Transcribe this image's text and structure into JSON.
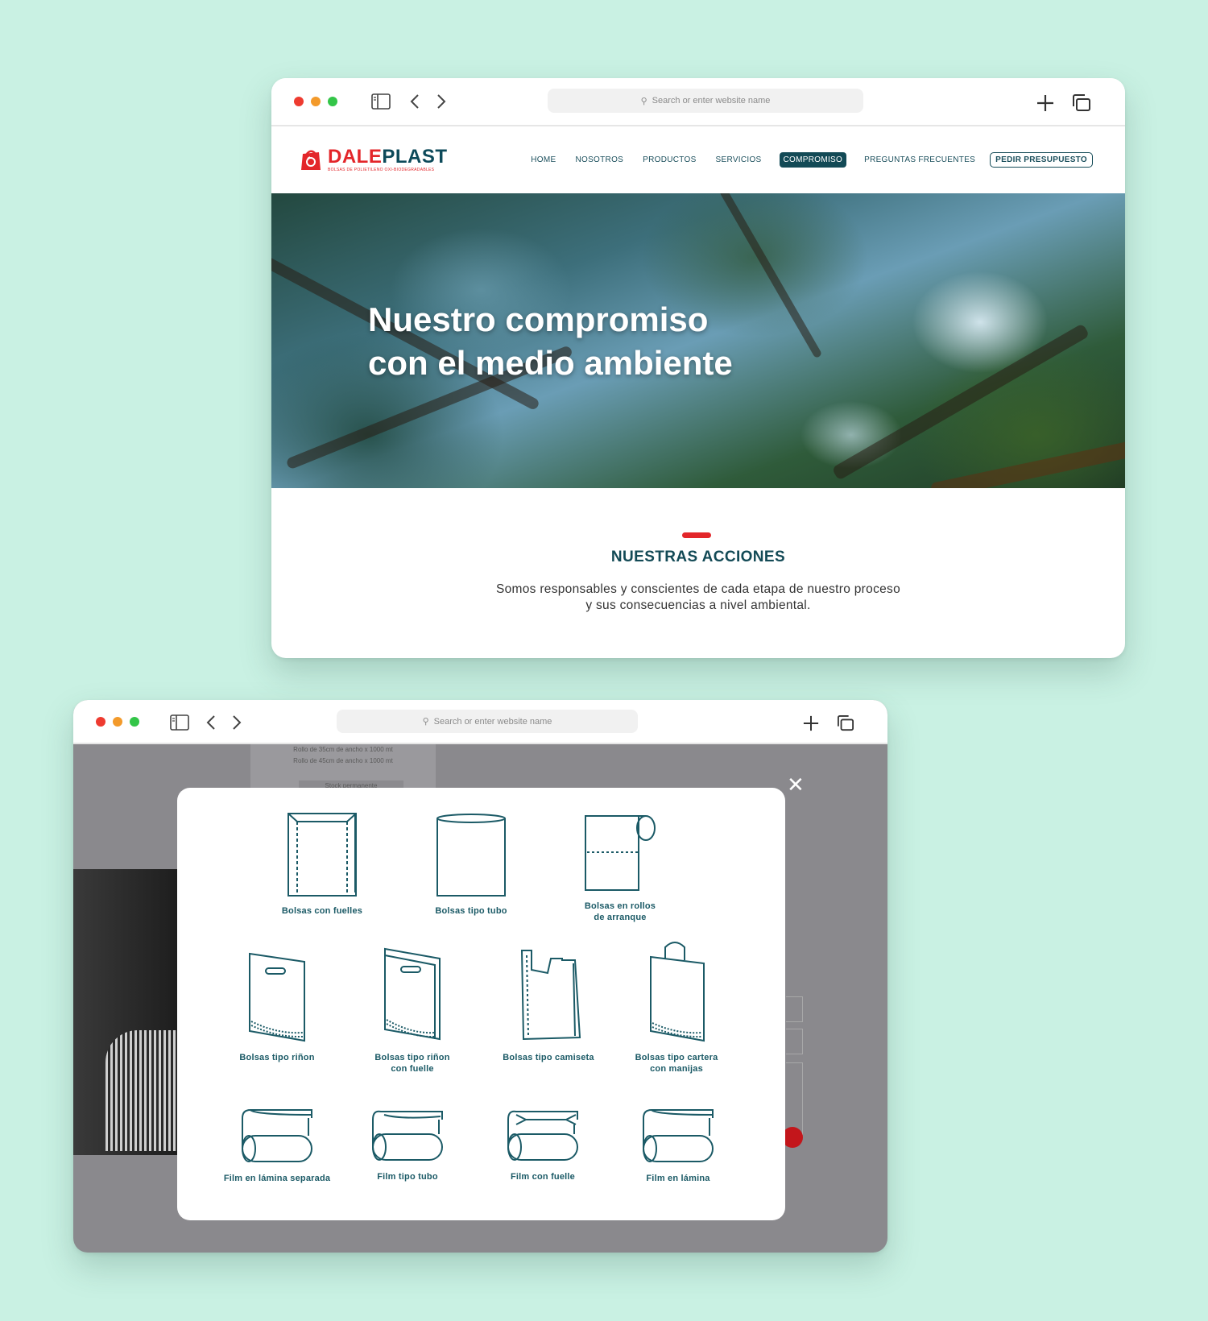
{
  "browser": {
    "url_placeholder": "Search or enter website name"
  },
  "site": {
    "logo": {
      "part1": "DALE",
      "part2": "PLAST",
      "tagline": "BOLSAS DE POLIETILENO OXI-BIODEGRADABLES"
    },
    "nav": [
      "HOME",
      "NOSOTROS",
      "PRODUCTOS",
      "SERVICIOS",
      "COMPROMISO",
      "PREGUNTAS FRECUENTES"
    ],
    "nav_active": "COMPROMISO",
    "cta": "PEDIR PRESUPUESTO",
    "hero": {
      "line1": "Nuestro compromiso",
      "line2": "con el medio ambiente"
    },
    "section": {
      "title": "NUESTRAS ACCIONES",
      "text_line1": "Somos responsables y conscientes de cada etapa de nuestro proceso",
      "text_line2": "y sus consecuencias a nivel ambiental."
    }
  },
  "background_page": {
    "card_line1": "Rollo de 35cm de ancho x 1000 mt",
    "card_line2": "Rollo de 45cm de ancho x 1000 mt",
    "card_badge": "Stock permanente"
  },
  "modal": {
    "row1": [
      {
        "label": "Bolsas con fuelles",
        "icon": "gusset-bag-icon"
      },
      {
        "label": "Bolsas tipo tubo",
        "icon": "tube-bag-icon"
      },
      {
        "label": "Bolsas en rollos\nde arranque",
        "icon": "roll-bag-icon"
      }
    ],
    "row2": [
      {
        "label": "Bolsas tipo riñon",
        "icon": "kidney-bag-icon"
      },
      {
        "label": "Bolsas tipo riñon\ncon fuelle",
        "icon": "kidney-gusset-bag-icon"
      },
      {
        "label": "Bolsas tipo camiseta",
        "icon": "tshirt-bag-icon"
      },
      {
        "label": "Bolsas tipo cartera\ncon manijas",
        "icon": "handle-bag-icon"
      }
    ],
    "row3": [
      {
        "label": "Film en lámina separada",
        "icon": "split-sheet-film-icon"
      },
      {
        "label": "Film tipo tubo",
        "icon": "tube-film-icon"
      },
      {
        "label": "Film con fuelle",
        "icon": "gusset-film-icon"
      },
      {
        "label": "Film en lámina",
        "icon": "sheet-film-icon"
      }
    ]
  },
  "colors": {
    "background": "#c9f1e3",
    "brand_red": "#e3262a",
    "brand_teal": "#134a56",
    "overlay": "#8a898d",
    "traffic_red": "#ee3b30",
    "traffic_yellow": "#f39a2b",
    "traffic_green": "#33c548"
  }
}
